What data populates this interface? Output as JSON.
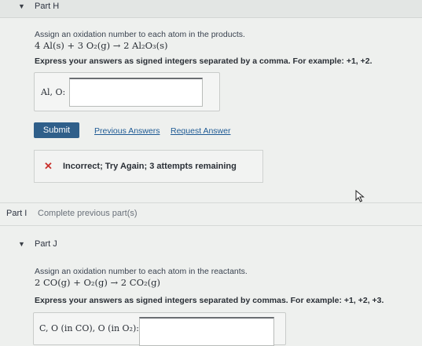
{
  "part_h": {
    "caret": "▼",
    "title": "Part H",
    "instruction": "Assign an oxidation number to each atom in the products.",
    "equation": "4 Al(s) + 3 O₂(g) → 2 Al₂O₃(s)",
    "format_note": "Express your answers as signed integers separated by a comma. For example: +1, +2.",
    "answer_label": "Al, O:",
    "answer_value": ""
  },
  "actions": {
    "submit": "Submit",
    "previous_answers": "Previous Answers",
    "request_answer": "Request Answer"
  },
  "feedback": {
    "icon": "✕",
    "message": "Incorrect; Try Again; 3 attempts remaining"
  },
  "part_i": {
    "label": "Part I",
    "status": "Complete previous part(s)"
  },
  "part_j": {
    "caret": "▼",
    "title": "Part J",
    "instruction": "Assign an oxidation number to each atom in the reactants.",
    "equation": "2 CO(g) + O₂(g) → 2 CO₂(g)",
    "format_note": "Express your answers as signed integers separated by commas. For example: +1, +2, +3.",
    "answer_label": "C, O (in CO), O (in O₂):",
    "answer_value": ""
  }
}
